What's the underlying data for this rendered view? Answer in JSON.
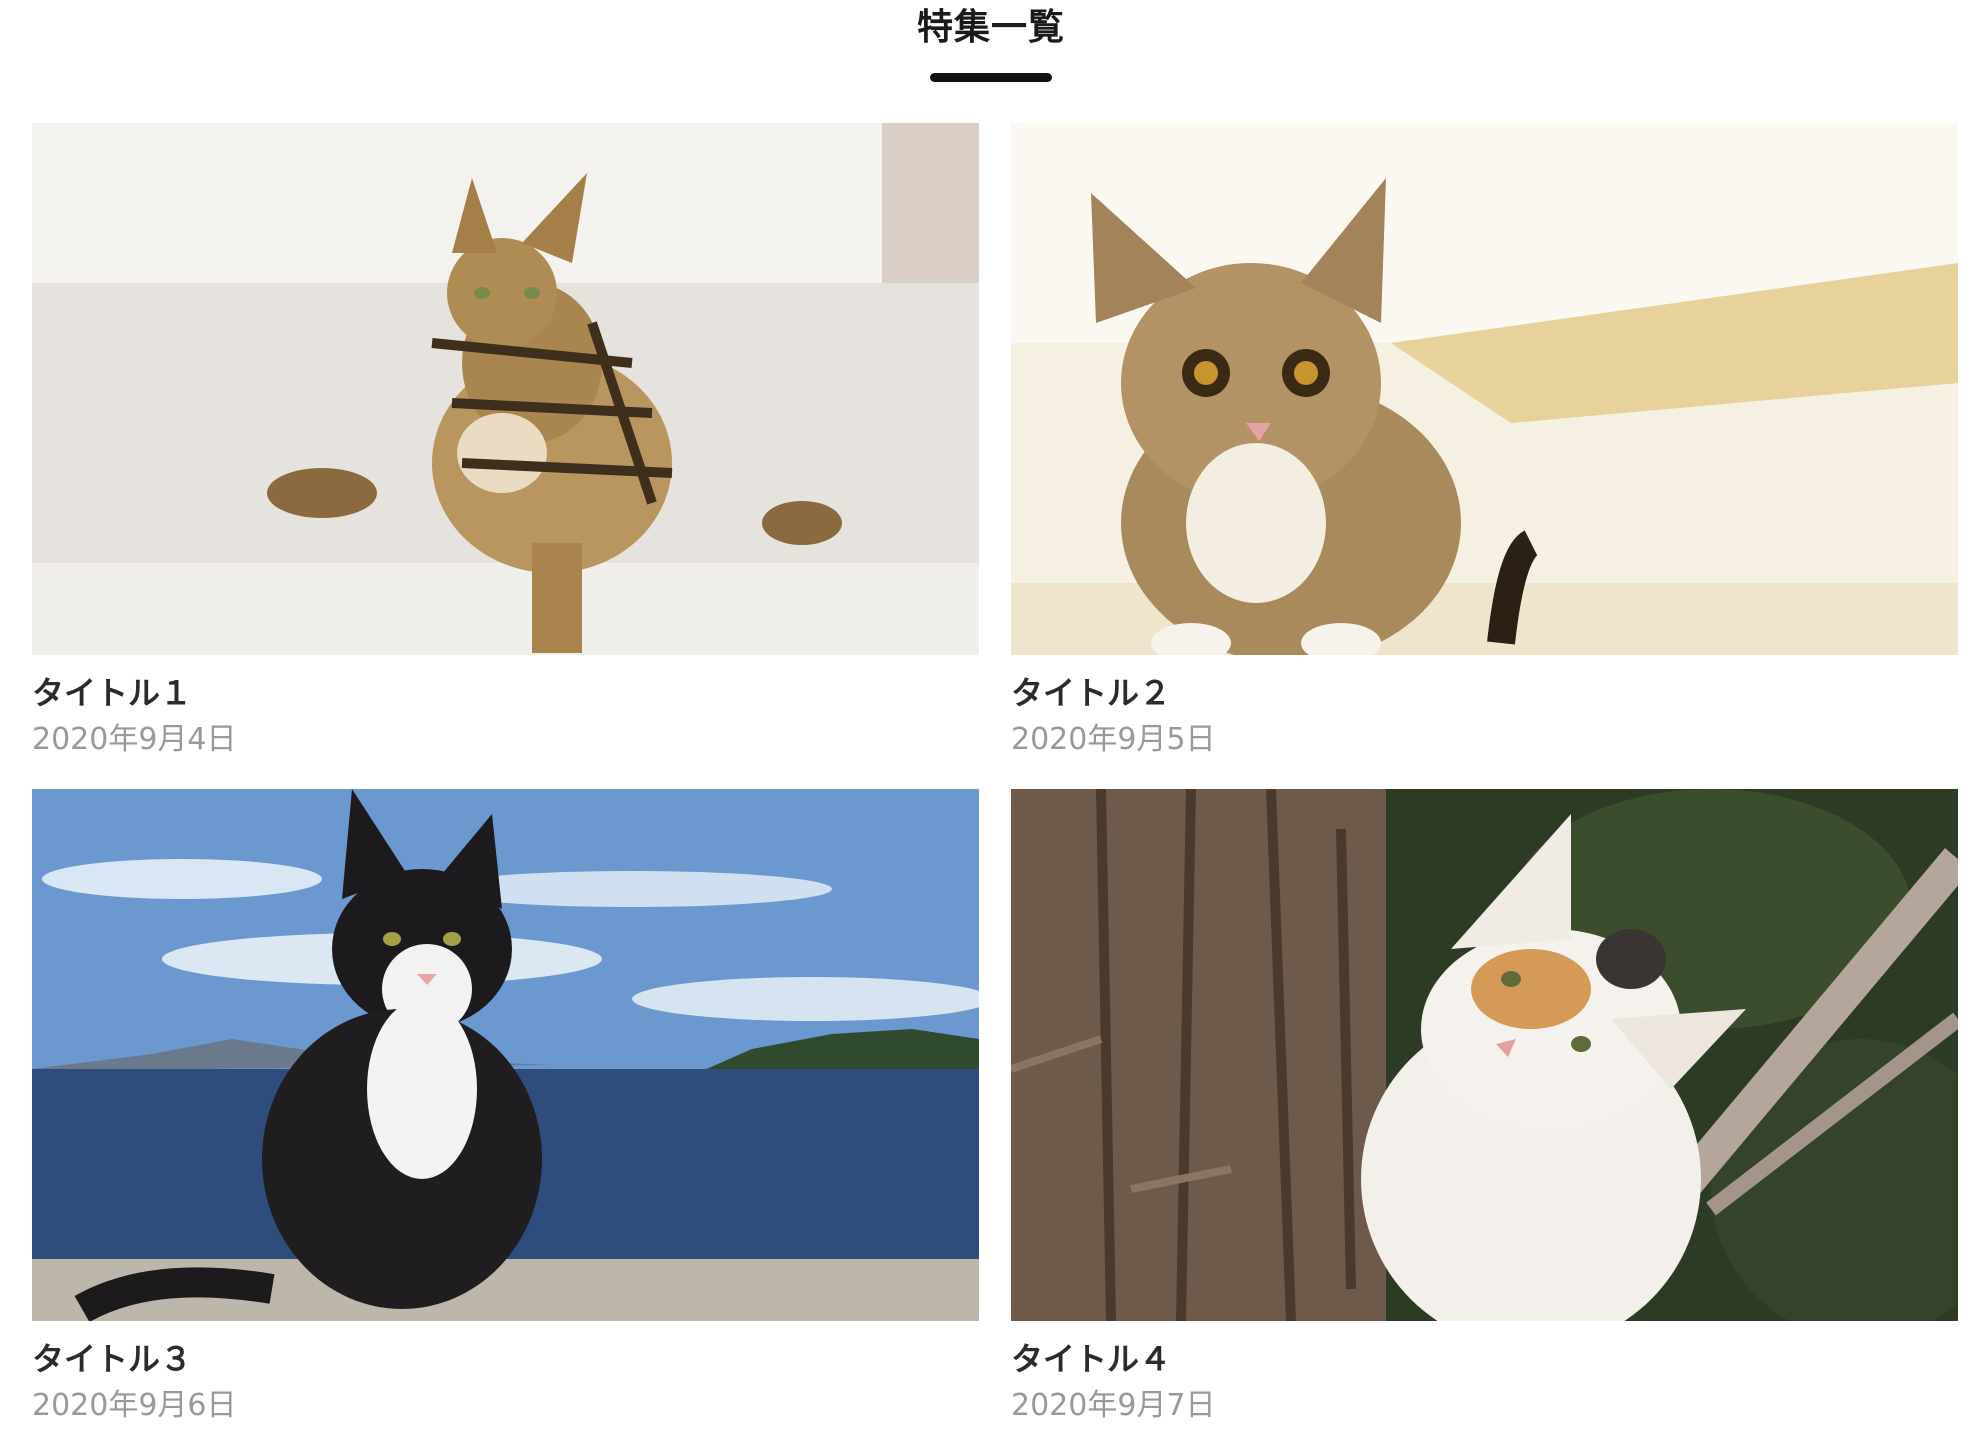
{
  "header": {
    "title": "特集一覧"
  },
  "cards": [
    {
      "title": "タイトル１",
      "date": "2020年9月4日",
      "image": "bengal-cat-sitting-on-bed"
    },
    {
      "title": "タイトル２",
      "date": "2020年9月5日",
      "image": "tabby-kitten-crouching"
    },
    {
      "title": "タイトル３",
      "date": "2020年9月6日",
      "image": "black-white-cat-by-sea"
    },
    {
      "title": "タイトル４",
      "date": "2020年9月7日",
      "image": "calico-cat-peeking-behind-tree"
    }
  ],
  "colors": {
    "title_text": "#1a1a1a",
    "underline": "#111111",
    "card_title_text": "#2b2b2b",
    "date_text": "#999999"
  }
}
